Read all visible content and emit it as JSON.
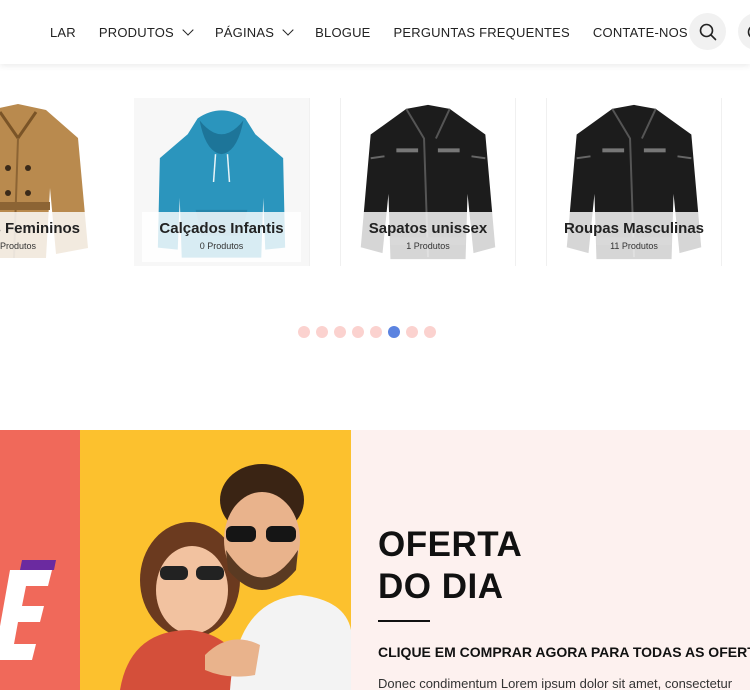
{
  "nav": {
    "items": [
      {
        "label": "LAR",
        "dropdown": false
      },
      {
        "label": "PRODUTOS",
        "dropdown": true
      },
      {
        "label": "PÁGINAS",
        "dropdown": true
      },
      {
        "label": "BLOGUE",
        "dropdown": false
      },
      {
        "label": "PERGUNTAS FREQUENTES",
        "dropdown": false
      },
      {
        "label": "CONTATE-NOS",
        "dropdown": false
      }
    ],
    "icons": [
      "search-icon",
      "account-icon"
    ]
  },
  "categories": [
    {
      "name": "s Femininos",
      "count": "Produtos",
      "image": "trench-coat"
    },
    {
      "name": "Calçados Infantis",
      "count": "0 Produtos",
      "image": "blue-hoodie"
    },
    {
      "name": "Sapatos unissex",
      "count": "1 Produtos",
      "image": "leather-jacket"
    },
    {
      "name": "Roupas Masculinas",
      "count": "11 Produtos",
      "image": "leather-jacket"
    }
  ],
  "carousel": {
    "dot_count": 8,
    "active_index": 5
  },
  "deal": {
    "title_line1": "OFERTA",
    "title_line2": "DO DIA",
    "subtitle": "CLIQUE EM COMPRAR AGORA PARA TODAS AS OFERTAS",
    "body": "Donec condimentum Lorem ipsum dolor sit amet, consectetur"
  },
  "colors": {
    "accent_dot": "#5b83e0",
    "dot": "#fbd2cf",
    "banner_yellow": "#fcc12e",
    "banner_coral": "#f0695a",
    "deal_bg": "#fdf1ef"
  }
}
